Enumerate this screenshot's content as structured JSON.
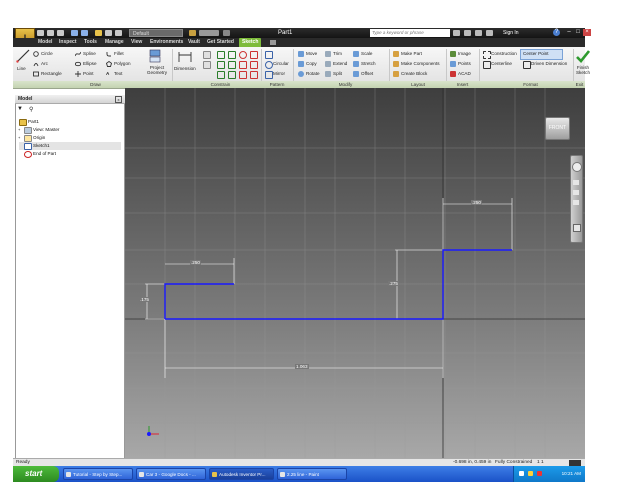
{
  "app": {
    "title": "Part1",
    "project": "Default",
    "search_placeholder": "Type a keyword or phrase",
    "sign_in": "Sign In",
    "help": "?"
  },
  "menu_tabs": [
    {
      "label": "Model"
    },
    {
      "label": "Inspect"
    },
    {
      "label": "Tools"
    },
    {
      "label": "Manage"
    },
    {
      "label": "View"
    },
    {
      "label": "Environments"
    },
    {
      "label": "Vault"
    },
    {
      "label": "Get Started"
    },
    {
      "label": "Sketch"
    }
  ],
  "ribbon": {
    "draw": {
      "title": "Draw",
      "line": "Line",
      "circle": "Circle",
      "arc": "Arc",
      "rectangle": "Rectangle",
      "spline": "Spline",
      "ellipse": "Ellipse",
      "point": "Point",
      "fillet": "Fillet",
      "polygon": "Polygon",
      "text": "Text",
      "project_geometry": "Project Geometry"
    },
    "constrain": {
      "title": "Constrain",
      "dimension": "Dimension"
    },
    "pattern": {
      "title": "Pattern",
      "rectangular": "",
      "circular": "Circular",
      "mirror": "Mirror"
    },
    "modify": {
      "title": "Modify",
      "move": "Move",
      "copy": "Copy",
      "rotate": "Rotate",
      "trim": "Trim",
      "extend": "Extend",
      "split": "Split",
      "scale": "Scale",
      "stretch": "Stretch",
      "offset": "Offset"
    },
    "layout": {
      "title": "Layout",
      "make_part": "Make Part",
      "make_components": "Make Components",
      "create_block": "Create Block"
    },
    "insert": {
      "title": "Insert",
      "image": "Image",
      "points": "Points",
      "acad": "ACAD"
    },
    "format": {
      "title": "Format",
      "construction": "Construction",
      "center_point": "Center Point",
      "centerline": "Centerline",
      "driven_dimension": "Driven Dimension"
    },
    "exit": {
      "title": "Exit",
      "finish_sketch": "Finish Sketch"
    }
  },
  "browser": {
    "title": "Model",
    "items": [
      {
        "label": "Part1"
      },
      {
        "label": "View: Master"
      },
      {
        "label": "Origin"
      },
      {
        "label": "Sketch1"
      },
      {
        "label": "End of Part"
      }
    ]
  },
  "sketch": {
    "dims": {
      "left_width": ".250",
      "left_height": ".175",
      "right_width": ".250",
      "middle_height": ".275",
      "total": "1.063"
    },
    "viewcube_label": "FRONT",
    "sketch_color": "#1a1aff"
  },
  "status": {
    "left": "Ready",
    "coords": "-0.698 in, 0.459 in",
    "constraint": "Fully Constrained",
    "counts": "1    1"
  },
  "taskbar": {
    "start": "start",
    "tasks": [
      {
        "label": "Tutorial - Step by Step..."
      },
      {
        "label": "Car 3 - Google Docs - ..."
      },
      {
        "label": "Autodesk Inventor Pr..."
      },
      {
        "label": "2.25 line - Paint"
      }
    ],
    "clock": "10:21 AM"
  }
}
